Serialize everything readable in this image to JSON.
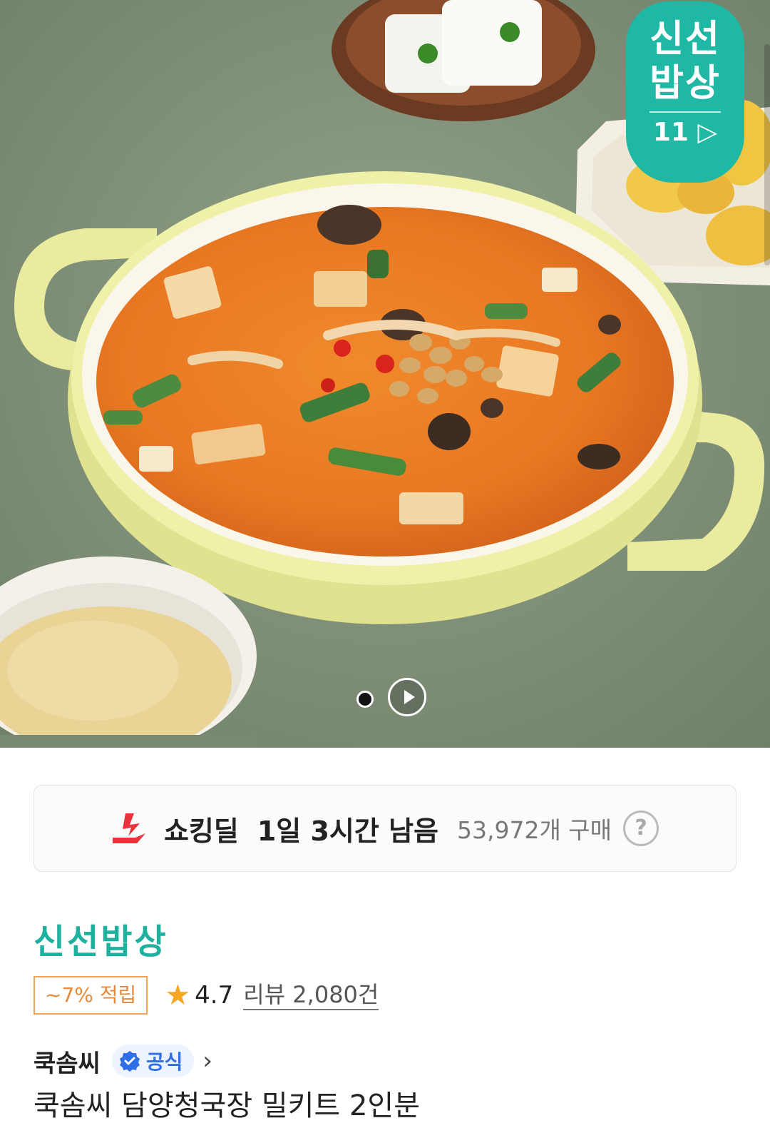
{
  "hero": {
    "badge": {
      "line1": "신선",
      "line2": "밥상",
      "logo": "11"
    },
    "carousel": {
      "pages": 1,
      "current": 1
    },
    "video_icon": "play-icon"
  },
  "deal": {
    "logo_icon": "shocking-deal-logo-icon",
    "title": "쇼킹딜",
    "time_left": "1일 3시간 남음",
    "purchase_count": "53,972개 구매",
    "help_icon": "?"
  },
  "store": {
    "name": "신선밥상"
  },
  "rating": {
    "points_badge": "~7% 적립",
    "star_icon": "★",
    "value": "4.7",
    "reviews": "리뷰 2,080건"
  },
  "seller": {
    "name": "쿡솜씨",
    "official_label": "공식",
    "chevron": "›"
  },
  "product": {
    "title": "쿡솜씨 담양청국장 밀키트 2인분"
  },
  "colors": {
    "brand_teal": "#1fb0a0",
    "points_orange": "#e8893a",
    "star": "#f5a623",
    "official_blue": "#2e6ee6",
    "deal_red": "#e8333a"
  }
}
